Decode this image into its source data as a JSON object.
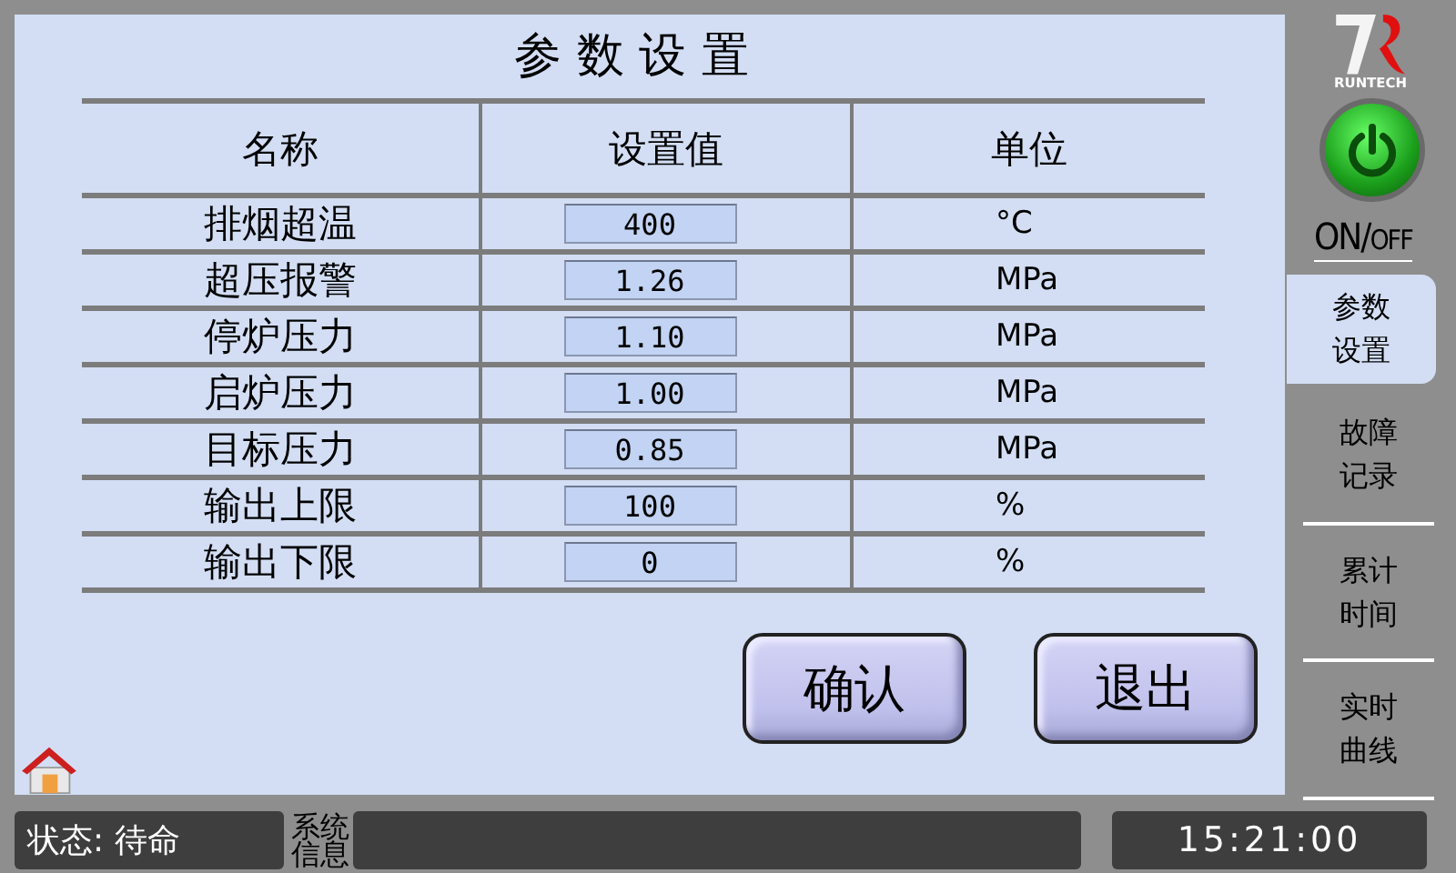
{
  "title": "参 数 设 置",
  "table": {
    "columns": [
      "名称",
      "设置值",
      "单位"
    ],
    "rows": [
      {
        "name": "排烟超温",
        "value": "400",
        "unit": "°C"
      },
      {
        "name": "超压报警",
        "value": "1.26",
        "unit": "MPa"
      },
      {
        "name": "停炉压力",
        "value": "1.10",
        "unit": "MPa"
      },
      {
        "name": "启炉压力",
        "value": "1.00",
        "unit": "MPa"
      },
      {
        "name": "目标压力",
        "value": "0.85",
        "unit": "MPa"
      },
      {
        "name": "输出上限",
        "value": "100",
        "unit": "%"
      },
      {
        "name": "输出下限",
        "value": "0",
        "unit": "%"
      }
    ]
  },
  "buttons": [
    "确认",
    "退出"
  ],
  "logo": {
    "text": "RUNTECH"
  },
  "power": {
    "on": true,
    "label_on": "ON/",
    "label_off": "OFF"
  },
  "tabs": [
    {
      "label": "参数设置",
      "selected": true
    },
    {
      "label": "故障记录",
      "selected": false
    },
    {
      "label": "累计时间",
      "selected": false
    },
    {
      "label": "实时曲线",
      "selected": false
    }
  ],
  "status_bar": {
    "status": "状态: 待命",
    "info_label": "系统信息",
    "time": "15:21:00"
  }
}
